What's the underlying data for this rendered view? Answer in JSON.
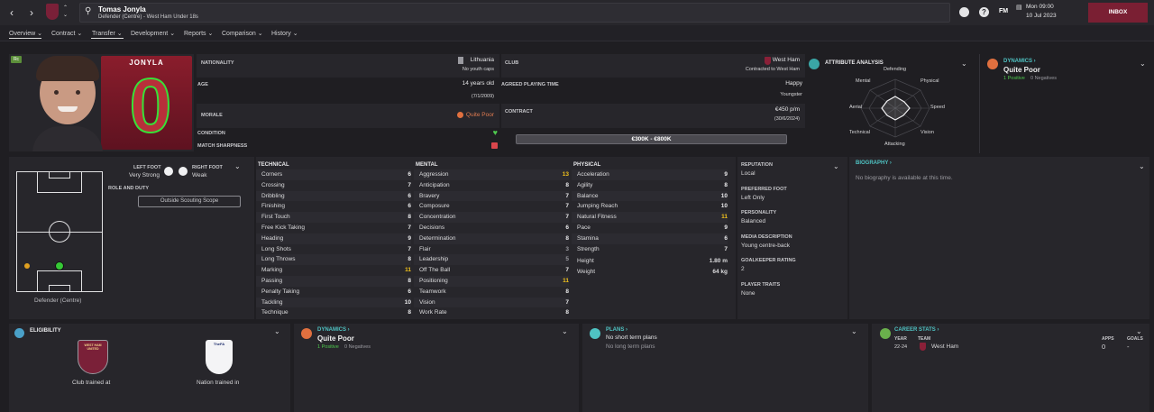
{
  "header": {
    "player_name": "Tomas Jonyla",
    "subtitle": "Defender (Centre) - West Ham Under 18s",
    "date_line1": "Mon 09:00",
    "date_line2": "10 Jul 2023",
    "fm_label": "FM",
    "inbox_label": "INBOX"
  },
  "tabs": [
    "Overview",
    "Contract",
    "Transfer",
    "Development",
    "Reports",
    "Comparison",
    "History"
  ],
  "profile": {
    "surname": "JONYLA",
    "shirt_number": "0",
    "status_badge": "Rc"
  },
  "info": {
    "nationality_label": "NATIONALITY",
    "nationality": "Lithuania",
    "youth_caps": "No youth caps",
    "age_label": "AGE",
    "age": "14 years old",
    "dob": "(7/1/2009)",
    "morale_label": "MORALE",
    "morale": "Quite Poor",
    "condition_label": "CONDITION",
    "sharpness_label": "MATCH SHARPNESS",
    "club_label": "CLUB",
    "club": "West Ham",
    "club_contract": "Contracted to West Ham",
    "apt_label": "AGREED PLAYING TIME",
    "apt": "Happy",
    "apt_role": "Youngster",
    "contract_label": "CONTRACT",
    "wage": "€450 p/m",
    "contract_end": "(30/6/2024)",
    "value_range": "€300K - €800K"
  },
  "attribute_analysis": {
    "title": "ATTRIBUTE ANALYSIS",
    "axes": [
      "Defending",
      "Physical",
      "Speed",
      "Vision",
      "Attacking",
      "Technical",
      "Aerial",
      "Mental"
    ]
  },
  "dynamics_top": {
    "title": "DYNAMICS",
    "value": "Quite Poor",
    "positives": "1 Positive",
    "negatives": "0 Negatives"
  },
  "pitch": {
    "left_foot_label": "LEFT FOOT",
    "left_foot": "Very Strong",
    "right_foot_label": "RIGHT FOOT",
    "right_foot": "Weak",
    "role_label": "ROLE AND DUTY",
    "scope_button": "Outside Scouting Scope",
    "position": "Defender (Centre)"
  },
  "technical": {
    "title": "TECHNICAL",
    "rows": [
      [
        "Corners",
        "6"
      ],
      [
        "Crossing",
        "7"
      ],
      [
        "Dribbling",
        "6"
      ],
      [
        "Finishing",
        "6"
      ],
      [
        "First Touch",
        "8"
      ],
      [
        "Free Kick Taking",
        "7"
      ],
      [
        "Heading",
        "9"
      ],
      [
        "Long Shots",
        "7"
      ],
      [
        "Long Throws",
        "8"
      ],
      [
        "Marking",
        "11"
      ],
      [
        "Passing",
        "8"
      ],
      [
        "Penalty Taking",
        "6"
      ],
      [
        "Tackling",
        "10"
      ],
      [
        "Technique",
        "8"
      ]
    ]
  },
  "mental": {
    "title": "MENTAL",
    "rows": [
      [
        "Aggression",
        "13"
      ],
      [
        "Anticipation",
        "8"
      ],
      [
        "Bravery",
        "7"
      ],
      [
        "Composure",
        "7"
      ],
      [
        "Concentration",
        "7"
      ],
      [
        "Decisions",
        "6"
      ],
      [
        "Determination",
        "8"
      ],
      [
        "Flair",
        "3"
      ],
      [
        "Leadership",
        "5"
      ],
      [
        "Off The Ball",
        "7"
      ],
      [
        "Positioning",
        "11"
      ],
      [
        "Teamwork",
        "8"
      ],
      [
        "Vision",
        "7"
      ],
      [
        "Work Rate",
        "8"
      ]
    ]
  },
  "physical": {
    "title": "PHYSICAL",
    "rows": [
      [
        "Acceleration",
        "9"
      ],
      [
        "Agility",
        "8"
      ],
      [
        "Balance",
        "10"
      ],
      [
        "Jumping Reach",
        "10"
      ],
      [
        "Natural Fitness",
        "11"
      ],
      [
        "Pace",
        "9"
      ],
      [
        "Stamina",
        "6"
      ],
      [
        "Strength",
        "7"
      ]
    ],
    "height_label": "Height",
    "height": "1.80 m",
    "weight_label": "Weight",
    "weight": "64 kg"
  },
  "side_info": [
    {
      "label": "REPUTATION",
      "value": "Local"
    },
    {
      "label": "PREFERRED FOOT",
      "value": "Left Only"
    },
    {
      "label": "PERSONALITY",
      "value": "Balanced"
    },
    {
      "label": "MEDIA DESCRIPTION",
      "value": "Young centre-back"
    },
    {
      "label": "GOALKEEPER RATING",
      "value": "2"
    },
    {
      "label": "PLAYER TRAITS",
      "value": "None"
    }
  ],
  "biography": {
    "title": "BIOGRAPHY",
    "text": "No biography is available at this time."
  },
  "eligibility": {
    "title": "ELIGIBILITY",
    "club_crest": "WEST HAM UNITED",
    "club_caption": "Club trained at",
    "nation_crest": "TheFA",
    "nation_caption": "Nation trained in"
  },
  "dynamics_bottom": {
    "title": "DYNAMICS",
    "value": "Quite Poor",
    "positives": "1 Positive",
    "negatives": "0 Negatives"
  },
  "plans": {
    "title": "PLANS",
    "short": "No short term plans",
    "long": "No long term plans"
  },
  "career": {
    "title": "CAREER STATS",
    "year_label": "YEAR",
    "team_label": "TEAM",
    "apps_label": "APPS",
    "goals_label": "GOALS",
    "year": "22-24",
    "team": "West Ham",
    "apps": "0",
    "goals": "-"
  }
}
